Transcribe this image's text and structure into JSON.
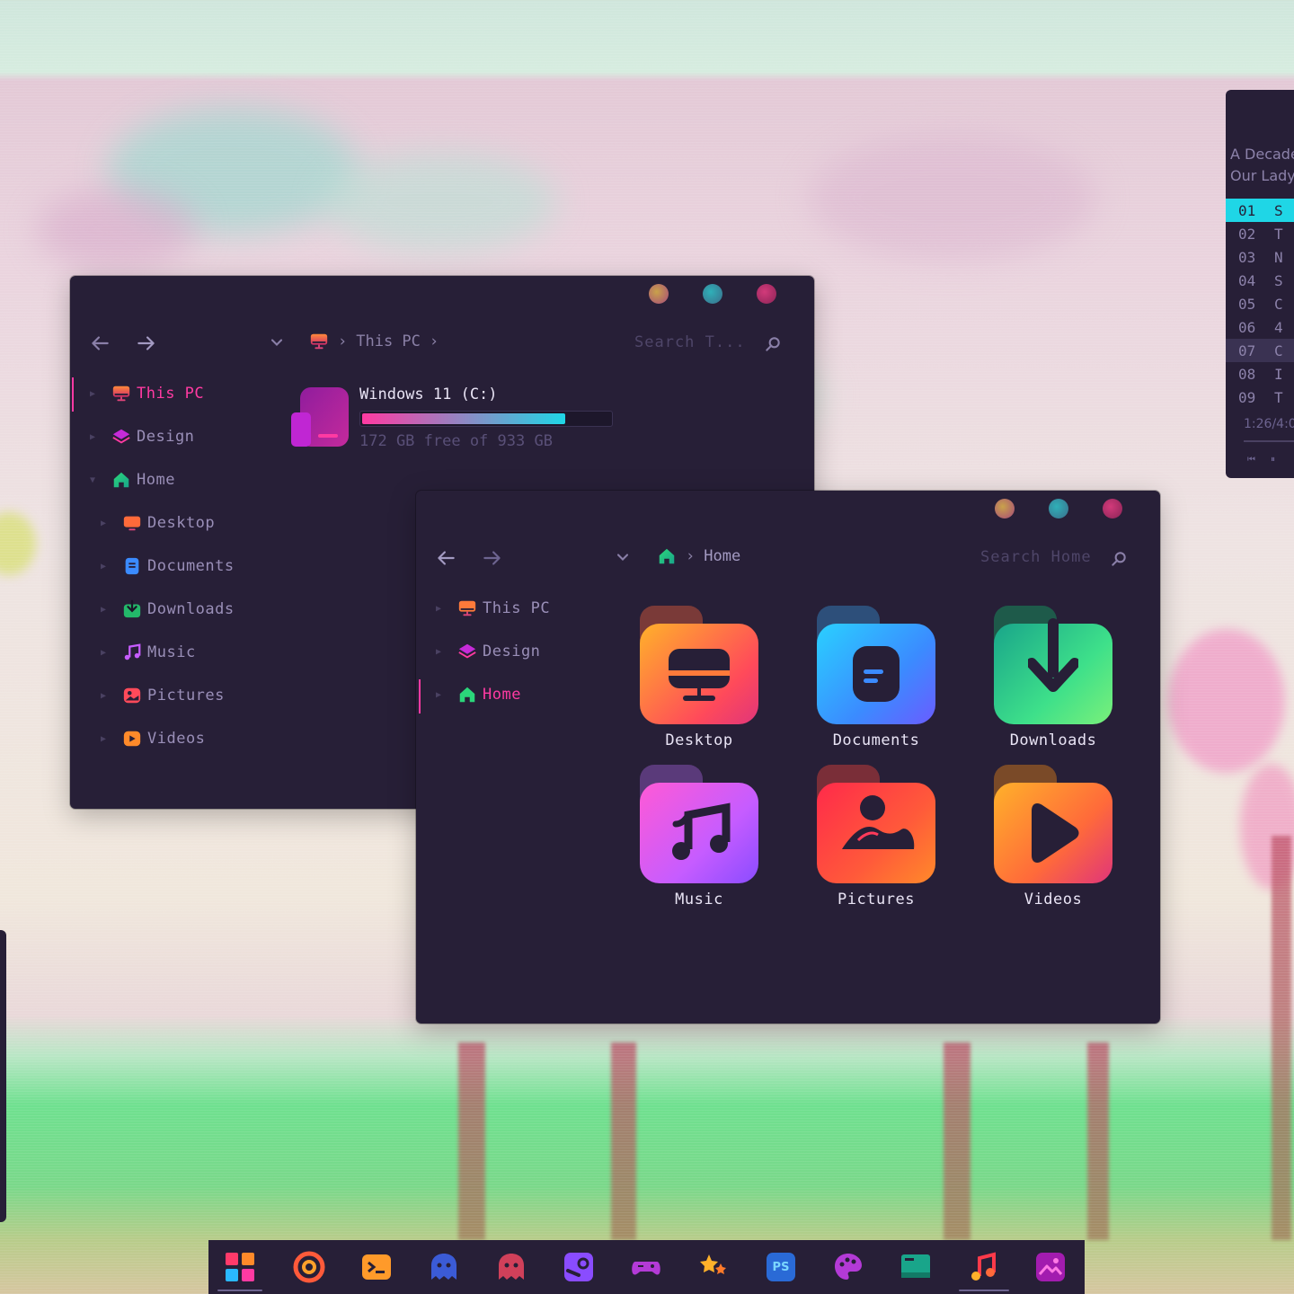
{
  "colors": {
    "window_bg": "#271f37",
    "accent_pink": "#ff3aa2",
    "accent_cyan": "#1fd6e6",
    "text_dim": "#9a8fb8",
    "text_bright": "#e9e4f5"
  },
  "explorer1": {
    "breadcrumb": "This PC",
    "search_placeholder": "Search T...",
    "sidebar": [
      {
        "label": "This PC",
        "icon": "monitor-icon",
        "active": true
      },
      {
        "label": "Design",
        "icon": "layers-icon"
      },
      {
        "label": "Home",
        "icon": "home-icon",
        "expanded": true
      },
      {
        "label": "Desktop",
        "icon": "desktop-icon"
      },
      {
        "label": "Documents",
        "icon": "documents-icon"
      },
      {
        "label": "Downloads",
        "icon": "downloads-icon"
      },
      {
        "label": "Music",
        "icon": "music-icon"
      },
      {
        "label": "Pictures",
        "icon": "pictures-icon"
      },
      {
        "label": "Videos",
        "icon": "videos-icon"
      }
    ],
    "drive": {
      "name": "Windows 11 (C:)",
      "free_text": "172 GB free of 933 GB",
      "used_fraction": 0.82
    }
  },
  "explorer2": {
    "breadcrumb": "Home",
    "search_placeholder": "Search Home",
    "sidebar": [
      {
        "label": "This PC",
        "icon": "monitor-icon"
      },
      {
        "label": "Design",
        "icon": "layers-icon"
      },
      {
        "label": "Home",
        "icon": "home-icon",
        "active": true
      }
    ],
    "folders": [
      {
        "label": "Desktop",
        "icon": "desktop-folder-icon"
      },
      {
        "label": "Documents",
        "icon": "documents-folder-icon"
      },
      {
        "label": "Downloads",
        "icon": "downloads-folder-icon"
      },
      {
        "label": "Music",
        "icon": "music-folder-icon"
      },
      {
        "label": "Pictures",
        "icon": "pictures-folder-icon"
      },
      {
        "label": "Videos",
        "icon": "videos-folder-icon"
      }
    ]
  },
  "player": {
    "album_line1": "A Decade",
    "album_line2": "Our Lady",
    "tracks": [
      {
        "num": "01",
        "initial": "S",
        "playing": true
      },
      {
        "num": "02",
        "initial": "T"
      },
      {
        "num": "03",
        "initial": "N"
      },
      {
        "num": "04",
        "initial": "S"
      },
      {
        "num": "05",
        "initial": "C"
      },
      {
        "num": "06",
        "initial": "4"
      },
      {
        "num": "07",
        "initial": "C",
        "highlighted": true
      },
      {
        "num": "08",
        "initial": "I"
      },
      {
        "num": "09",
        "initial": "T"
      }
    ],
    "time": "1:26/4:0"
  },
  "taskbar": {
    "apps": [
      "start-icon",
      "chrome-icon",
      "terminal-icon",
      "ghost-blue-icon",
      "ghost-red-icon",
      "steam-icon",
      "gamepad-icon",
      "stars-icon",
      "photoshop-icon",
      "palette-icon",
      "monitor-app-icon",
      "music-app-icon",
      "gallery-icon"
    ],
    "ps_label": "PS"
  }
}
